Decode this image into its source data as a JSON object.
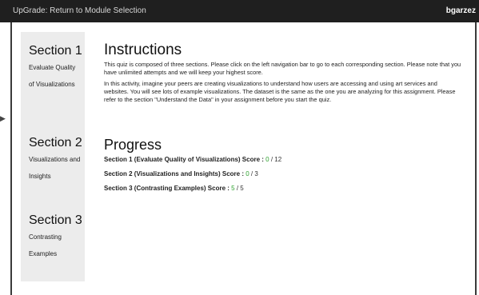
{
  "topbar": {
    "back_link": "UpGrade: Return to Module Selection",
    "username": "bgarzez",
    "background": "#1f1f1f"
  },
  "sidebar": {
    "sections": [
      {
        "title": "Section 1",
        "description": "Evaluate Quality of Visualizations"
      },
      {
        "title": "Section 2",
        "description": "Visualizations and Insights"
      },
      {
        "title": "Section 3",
        "description": "Contrasting Examples"
      }
    ]
  },
  "instructions": {
    "heading": "Instructions",
    "paragraph1": "This quiz is composed of three sections. Please click on the left navigation bar to go to each corresponding section. Please note that you have unlimited attempts and we will keep your highest score.",
    "paragraph2": "In this activity, imagine your peers are creating visualizations to understand how users are accessing and using art services and websites. You will see lots of example visualizations. The dataset is the same as the one you are analyzing for this assignment. Please refer to the section \"Understand the Data\" in your assignment before you start the quiz."
  },
  "progress": {
    "heading": "Progress",
    "scores": [
      {
        "label": "Section 1 (Evaluate Quality of Visualizations) Score : ",
        "earned": "0",
        "total": " / 12"
      },
      {
        "label": "Section 2 (Visualizations and Insights) Score : ",
        "earned": "0",
        "total": " / 3"
      },
      {
        "label": "Section 3 (Contrasting Examples) Score : ",
        "earned": "5",
        "total": " / 5"
      }
    ],
    "earned_color": "#2ea12e"
  }
}
